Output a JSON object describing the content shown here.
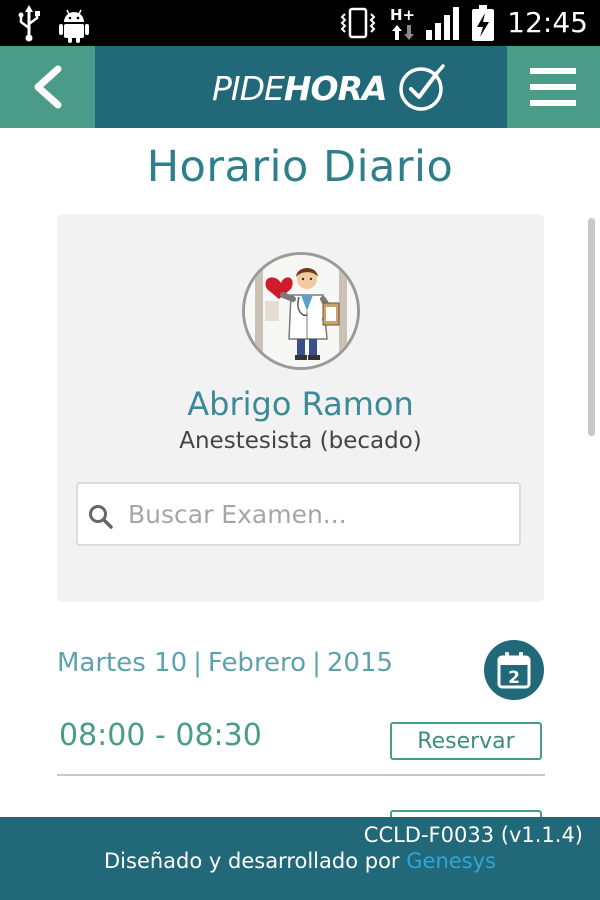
{
  "status_bar": {
    "time": "12:45",
    "network_icon_text": "H+",
    "icons": [
      "usb-icon",
      "android-icon",
      "vibrate-icon",
      "network-hplus-icon",
      "signal-icon",
      "battery-charging-icon"
    ]
  },
  "header": {
    "back_icon": "chevron-left-icon",
    "menu_icon": "hamburger-menu-icon",
    "logo": {
      "light": "PIDE",
      "bold": "HORA",
      "icon": "clock-check-icon"
    }
  },
  "page": {
    "title": "Horario Diario"
  },
  "doctor": {
    "avatar_icon": "doctor-avatar-icon",
    "name": "Abrigo Ramon",
    "specialty": "Anestesista (becado)"
  },
  "search": {
    "placeholder": "Buscar Examen...",
    "value": "",
    "icon": "search-icon"
  },
  "date": {
    "weekday_day": "Martes 10",
    "month": "Febrero",
    "year": "2015",
    "separator": "|",
    "calendar_day": "2",
    "calendar_icon": "calendar-icon"
  },
  "slots": [
    {
      "time": "08:00 - 08:30",
      "action": "Reservar"
    },
    {
      "time": "",
      "action": ""
    }
  ],
  "footer": {
    "version": "CCLD-F0033 (v1.1.4)",
    "credits_prefix": "Diseñado y desarrollado por",
    "company": "Genesys"
  },
  "colors": {
    "header_bg": "#216878",
    "header_button_bg": "#4a9c88",
    "title": "#2e7f8c",
    "accent_green": "#4a9c88",
    "link": "#2fa6d7"
  }
}
